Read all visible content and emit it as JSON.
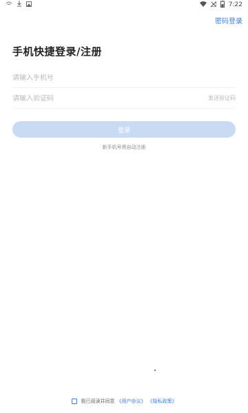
{
  "status_bar": {
    "time": "7:22",
    "left_icons": [
      "wifi-icon",
      "download-icon",
      "image-icon"
    ],
    "right_icons": [
      "signal-icon",
      "no-sim-icon",
      "battery-icon"
    ]
  },
  "header": {
    "password_login": "密码登录"
  },
  "main": {
    "title": "手机快捷登录/注册",
    "phone_placeholder": "请输入手机号",
    "code_placeholder": "请输入验证码",
    "send_code": "发送验证码",
    "login_button": "登录",
    "auto_register_hint": "新手机号将自动注册"
  },
  "agreement": {
    "text": "我已阅读并同意",
    "user_agreement": "《用户协议》",
    "privacy_policy": "《隐私政策》"
  },
  "colors": {
    "accent": "#3d7dd8",
    "button_disabled": "#c9dbf2"
  }
}
